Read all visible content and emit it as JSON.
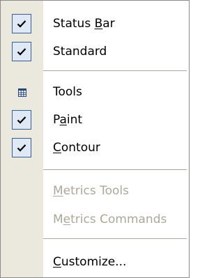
{
  "menu": {
    "items": [
      {
        "id": "status-bar",
        "before": "Status ",
        "mnemonic": "B",
        "after": "ar",
        "checked": true,
        "enabled": true,
        "icon": "check-icon"
      },
      {
        "id": "standard",
        "before": "Standard",
        "mnemonic": "",
        "after": "",
        "checked": true,
        "enabled": true,
        "icon": "check-icon"
      },
      {
        "id": "tools",
        "before": "Tools",
        "mnemonic": "",
        "after": "",
        "checked": false,
        "enabled": true,
        "icon": "toolbar-grid-icon"
      },
      {
        "id": "paint",
        "before": "P",
        "mnemonic": "a",
        "after": "int",
        "checked": true,
        "enabled": true,
        "icon": "check-icon"
      },
      {
        "id": "contour",
        "before": "",
        "mnemonic": "C",
        "after": "ontour",
        "checked": true,
        "enabled": true,
        "icon": "check-icon"
      },
      {
        "id": "metrics-tools",
        "before": "",
        "mnemonic": "M",
        "after": "etrics Tools",
        "checked": false,
        "enabled": false,
        "icon": ""
      },
      {
        "id": "metrics-commands",
        "before": "M",
        "mnemonic": "e",
        "after": "trics Commands",
        "checked": false,
        "enabled": false,
        "icon": ""
      },
      {
        "id": "customize",
        "before": "",
        "mnemonic": "C",
        "after": "ustomize...",
        "checked": false,
        "enabled": true,
        "icon": ""
      }
    ]
  },
  "colors": {
    "gutter": "#ebe9dd",
    "checkbox_border": "#315f9d",
    "checkbox_fill": "#dfe9f6",
    "separator": "#aca899",
    "disabled_text": "#aca899"
  }
}
